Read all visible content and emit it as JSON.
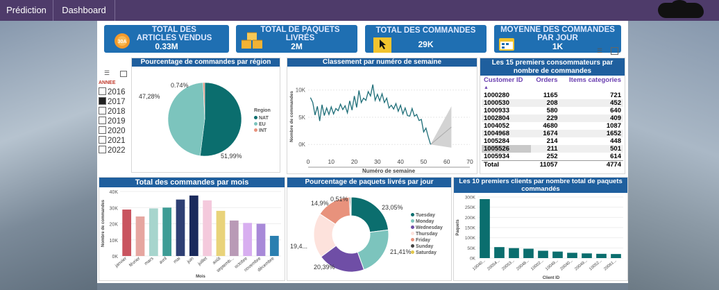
{
  "nav": {
    "prediction": "Prédiction",
    "dashboard": "Dashboard"
  },
  "kpis": [
    {
      "title": "TOTAL DES ARTICLES VENDUS",
      "value": "0.33M",
      "icon": "coin-icon"
    },
    {
      "title": "TOTAL DE PAQUETS LIVRÉS",
      "value": "2M",
      "icon": "boxes-icon"
    },
    {
      "title": "TOTAL DES COMMANDES",
      "value": "29K",
      "icon": "cursor-icon"
    },
    {
      "title": "MOYENNE DES COMMANDES PAR JOUR",
      "value": "1K",
      "icon": "calendar-icon"
    }
  ],
  "slicer": {
    "title": "ANNEE",
    "years": [
      "2016",
      "2017",
      "2018",
      "2019",
      "2020",
      "2021",
      "2022"
    ],
    "selected": "2017"
  },
  "pie_region": {
    "title": "Pourcentage de commandes par région",
    "legend_title": "Region",
    "labels": {
      "nat": "51,99%",
      "eu": "47,28%",
      "int": "0.74%"
    },
    "chart_data": {
      "type": "pie",
      "categories": [
        "NAT",
        "EU",
        "INT"
      ],
      "values": [
        51.99,
        47.28,
        0.74
      ],
      "colors": [
        "#0b6e6e",
        "#7cc4bd",
        "#e8927c"
      ]
    }
  },
  "week_chart": {
    "title": "Classement par numéro de semaine",
    "ylabel": "Nombre de commandes",
    "xlabel": "Numéro de semaine",
    "yticks": [
      "10K",
      "5K",
      "0K"
    ],
    "xticks": [
      "0",
      "10",
      "20",
      "30",
      "40",
      "50",
      "60",
      "70"
    ],
    "chart_data": {
      "type": "line",
      "x": [
        1,
        2,
        3,
        4,
        5,
        6,
        7,
        8,
        9,
        10,
        11,
        12,
        13,
        14,
        15,
        16,
        17,
        18,
        19,
        20,
        21,
        22,
        23,
        24,
        25,
        26,
        27,
        28,
        29,
        30,
        31,
        32,
        33,
        34,
        35,
        36,
        37,
        38,
        39,
        40,
        41,
        42,
        43,
        44,
        45,
        46,
        47,
        48,
        49,
        50,
        51,
        52,
        53
      ],
      "values": [
        8600,
        7700,
        5400,
        7000,
        4300,
        7300,
        5300,
        6700,
        5500,
        6900,
        5600,
        6600,
        6200,
        7400,
        6400,
        7100,
        5800,
        8000,
        6300,
        8900,
        6800,
        9900,
        7700,
        8500,
        8100,
        9700,
        8900,
        11000,
        8100,
        9200,
        8000,
        9300,
        7700,
        8500,
        6700,
        7200,
        6500,
        7500,
        6100,
        7200,
        5600,
        6700,
        5300,
        5200,
        6600,
        5200,
        5500,
        4400,
        4600,
        2300,
        3000,
        1400,
        0
      ],
      "ylim": [
        -1500,
        12000
      ],
      "xlim": [
        0,
        70
      ]
    }
  },
  "top15": {
    "title": "Les 15 premiers consommateurs par nombre de commandes",
    "headers": [
      "Customer ID",
      "Orders",
      "Items categories"
    ],
    "rows": [
      [
        "1000280",
        "1165",
        "721"
      ],
      [
        "1000530",
        "208",
        "452"
      ],
      [
        "1000933",
        "580",
        "640"
      ],
      [
        "1002804",
        "229",
        "409"
      ],
      [
        "1004052",
        "4680",
        "1087"
      ],
      [
        "1004968",
        "1674",
        "1652"
      ],
      [
        "1005284",
        "214",
        "448"
      ],
      [
        "1005526",
        "211",
        "501"
      ],
      [
        "1005934",
        "252",
        "614"
      ]
    ],
    "total": [
      "Total",
      "11057",
      "4774"
    ]
  },
  "monthly": {
    "title": "Total des commandes par mois",
    "ylabel": "Nombre de commandes",
    "xlabel": "Mois",
    "yticks": [
      "40K",
      "30K",
      "20K",
      "10K",
      "0K"
    ],
    "chart_data": {
      "type": "bar",
      "categories": [
        "janvier",
        "février",
        "mars",
        "avril",
        "mai",
        "juin",
        "juillet",
        "août",
        "septemb...",
        "octobre",
        "novembre",
        "décembre"
      ],
      "values": [
        28800,
        24500,
        29500,
        30000,
        35000,
        37500,
        34500,
        28000,
        22000,
        20500,
        20000,
        12500
      ],
      "colors": [
        "#c9545f",
        "#e6a6a0",
        "#a7d5cd",
        "#3d9c95",
        "#2e3f73",
        "#1a2a5c",
        "#f4c9dc",
        "#e9d37a",
        "#b99ab6",
        "#d8aef0",
        "#a889d8",
        "#2a7fb0"
      ],
      "ylim": [
        0,
        40000
      ]
    }
  },
  "donut": {
    "title": "Pourcentage de paquets livrés par jour",
    "labels": {
      "tuesday": "23,05%",
      "monday": "21,41%",
      "wednesday": "20,39%",
      "thursday": "19,4...",
      "friday": "14,9%",
      "sunday": "0,51%"
    },
    "chart_data": {
      "type": "pie",
      "categories": [
        "Tuesday",
        "Monday",
        "Wednesday",
        "Thursday",
        "Friday",
        "Sunday",
        "Saturday"
      ],
      "values": [
        23.05,
        21.41,
        20.39,
        19.4,
        14.9,
        0.51,
        0.34
      ],
      "colors": [
        "#0b6e6e",
        "#7cc4bd",
        "#6f4ea6",
        "#fde2dc",
        "#e8927c",
        "#444444",
        "#e3c84a"
      ]
    }
  },
  "top10": {
    "title": "Les 10 premiers clients par nombre total de paquets commandés",
    "ylabel": "Paquets",
    "xlabel": "Client ID",
    "yticks": [
      "300K",
      "250K",
      "200K",
      "150K",
      "100K",
      "50K",
      "0K"
    ],
    "chart_data": {
      "type": "bar",
      "categories": [
        "10040...",
        "20054...",
        "20053...",
        "20048...",
        "10002...",
        "10049...",
        "20040...",
        "20049...",
        "10052...",
        "20061..."
      ],
      "values": [
        290000,
        54000,
        49000,
        46000,
        36000,
        32000,
        26000,
        23000,
        21000,
        20000
      ],
      "color": "#0b6e6e",
      "ylim": [
        0,
        300000
      ]
    }
  }
}
